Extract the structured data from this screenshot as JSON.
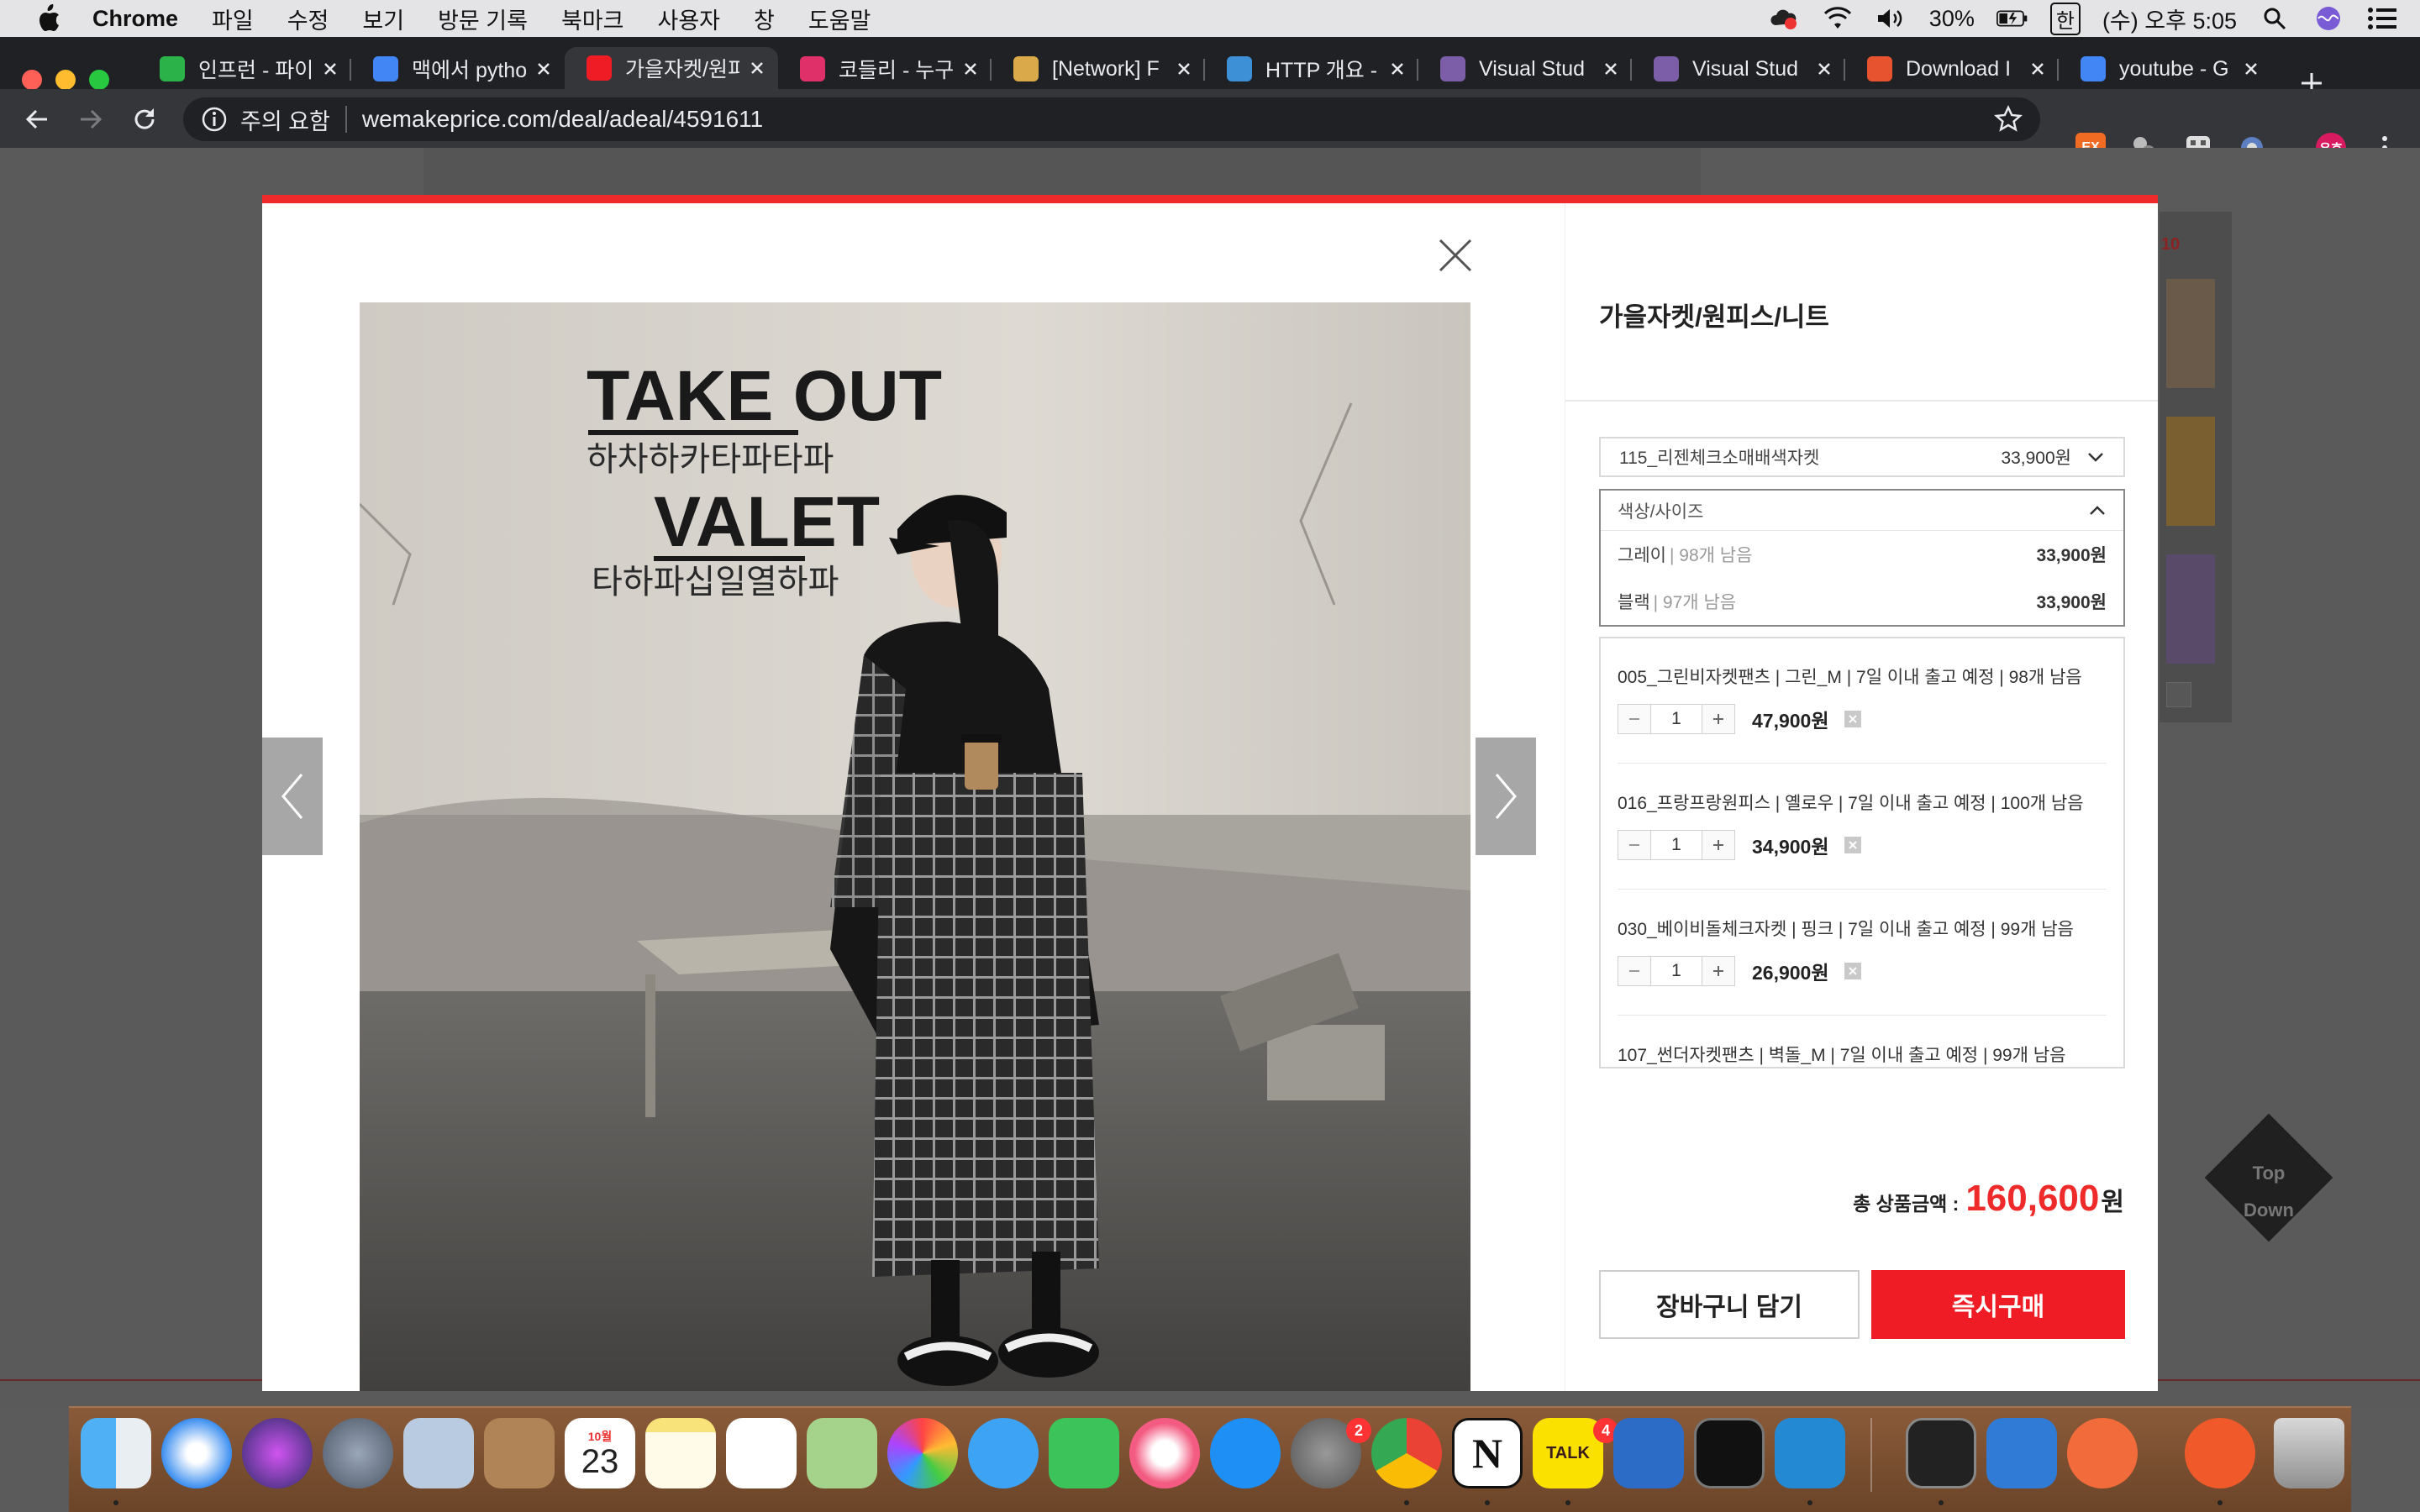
{
  "menubar": {
    "items": [
      "Chrome",
      "파일",
      "수정",
      "보기",
      "방문 기록",
      "북마크",
      "사용자",
      "창",
      "도움말"
    ],
    "battery": "30%",
    "input_source": "한",
    "clock": "(수) 오후 5:05"
  },
  "browser": {
    "tabs": [
      {
        "title": "인프런 - 파이",
        "icon": "inflearn-icon",
        "color": "#2bb34a"
      },
      {
        "title": "맥에서 python",
        "icon": "google-icon",
        "color": "#4285f4"
      },
      {
        "title": "가을자켓/원피",
        "icon": "wemakeprice-icon",
        "color": "#ef1c25"
      },
      {
        "title": "코들리 - 누구",
        "icon": "codely-icon",
        "color": "#e0306a"
      },
      {
        "title": "[Network] F",
        "icon": "network-icon",
        "color": "#d9a94a"
      },
      {
        "title": "HTTP 개요 -",
        "icon": "mdn-icon",
        "color": "#3d8fd6"
      },
      {
        "title": "Visual Stud",
        "icon": "visual-studio-icon",
        "color": "#7b5ea7"
      },
      {
        "title": "Visual Stud",
        "icon": "visual-studio-icon",
        "color": "#7b5ea7"
      },
      {
        "title": "Download I",
        "icon": "download-icon",
        "color": "#e8532f"
      },
      {
        "title": "youtube - G",
        "icon": "google-icon",
        "color": "#4285f4"
      }
    ],
    "active_tab_index": 2,
    "security_label": "주의 요함",
    "url": "wemakeprice.com/deal/adeal/4591611",
    "ext_ex_label": "EX",
    "profile_label": "유호"
  },
  "modal": {
    "title": "가을자켓/원피스/니트",
    "selected_product": {
      "name": "115_리젠체크소매배색자켓",
      "price": "33,900원"
    },
    "option_select": {
      "label": "색상/사이즈",
      "options": [
        {
          "name": "그레이",
          "remaining": "| 98개 남음",
          "price": "33,900원"
        },
        {
          "name": "블랙",
          "remaining": "| 97개 남음",
          "price": "33,900원"
        }
      ]
    },
    "items": [
      {
        "name": "005_그린비자켓팬츠 | 그린_M | 7일 이내 출고 예정 | 98개 남음",
        "qty": "1",
        "price": "47,900원"
      },
      {
        "name": "016_프랑프랑원피스 | 옐로우 | 7일 이내 출고 예정 | 100개 남음",
        "qty": "1",
        "price": "34,900원"
      },
      {
        "name": "030_베이비돌체크자켓 | 핑크 | 7일 이내 출고 예정 | 99개 남음",
        "qty": "1",
        "price": "26,900원"
      },
      {
        "name": "107_썬더자켓팬츠 | 벽돌_M | 7일 이내 출고 예정 | 99개 남음",
        "qty": "1",
        "price": ""
      }
    ],
    "total_label": "총 상품금액 :",
    "total_amount": "160,600",
    "total_unit": "원",
    "cart_button": "장바구니 담기",
    "buy_button": "즉시구매",
    "photo_text": {
      "line1": "TAKE OUT",
      "line2": "하차하카타파타파",
      "line3": "VALET",
      "line4": "타하파십일열하파"
    }
  },
  "page_side": {
    "top_label": "Top",
    "down_label": "Down",
    "side_number": "10"
  },
  "dock": {
    "calendar_month": "10월",
    "calendar_day": "23",
    "badges": {
      "system_prefs": "2",
      "kakaotalk": "4"
    },
    "kakaotalk_label": "TALK",
    "notion_label": "N",
    "icons": [
      "finder-icon",
      "safari-icon",
      "siri-icon",
      "launchpad-icon",
      "mail-icon",
      "contacts-icon",
      "calendar-icon",
      "notes-icon",
      "reminders-icon",
      "maps-icon",
      "photos-icon",
      "messages-icon",
      "facetime-icon",
      "music-icon",
      "app-store-icon",
      "system-preferences-icon",
      "chrome-icon",
      "notion-icon",
      "kakaotalk-icon",
      "xcode-icon",
      "activity-monitor-icon",
      "vscode-icon",
      "terminal-icon",
      "hangul-dictionary-icon",
      "pages-icon",
      "postman-icon",
      "trash-icon"
    ]
  }
}
